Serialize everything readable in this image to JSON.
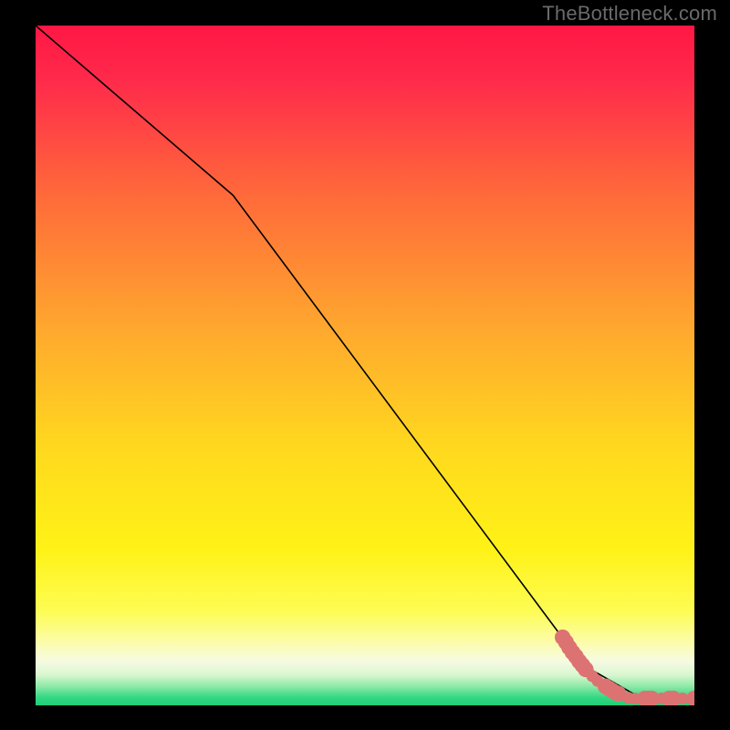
{
  "attribution": "TheBottleneck.com",
  "chart_data": {
    "type": "line",
    "title": "",
    "xlabel": "",
    "ylabel": "",
    "xlim": [
      0,
      100
    ],
    "ylim": [
      0,
      100
    ],
    "grid": false,
    "series": [
      {
        "name": "bottleneck-curve",
        "x": [
          0,
          30,
          83,
          92,
          100
        ],
        "y": [
          100,
          75,
          6,
          1,
          1
        ],
        "color": "#000000"
      }
    ],
    "markers": {
      "name": "data-points",
      "color": "#dd7272",
      "points": [
        {
          "x": 80.0,
          "y": 10.0,
          "r": 1.2
        },
        {
          "x": 80.5,
          "y": 9.3,
          "r": 1.2
        },
        {
          "x": 81.0,
          "y": 8.5,
          "r": 1.2
        },
        {
          "x": 81.5,
          "y": 7.8,
          "r": 1.2
        },
        {
          "x": 82.0,
          "y": 7.2,
          "r": 1.2
        },
        {
          "x": 82.5,
          "y": 6.5,
          "r": 1.2
        },
        {
          "x": 83.0,
          "y": 5.9,
          "r": 1.2
        },
        {
          "x": 83.5,
          "y": 5.3,
          "r": 1.2
        },
        {
          "x": 84.5,
          "y": 4.3,
          "r": 0.9
        },
        {
          "x": 85.3,
          "y": 3.6,
          "r": 0.9
        },
        {
          "x": 86.5,
          "y": 2.8,
          "r": 1.2
        },
        {
          "x": 87.0,
          "y": 2.5,
          "r": 1.2
        },
        {
          "x": 87.5,
          "y": 2.2,
          "r": 1.2
        },
        {
          "x": 88.0,
          "y": 1.9,
          "r": 1.2
        },
        {
          "x": 88.5,
          "y": 1.7,
          "r": 1.2
        },
        {
          "x": 90.0,
          "y": 1.1,
          "r": 0.9
        },
        {
          "x": 91.0,
          "y": 1.0,
          "r": 0.9
        },
        {
          "x": 92.5,
          "y": 1.0,
          "r": 1.2
        },
        {
          "x": 93.0,
          "y": 1.0,
          "r": 1.2
        },
        {
          "x": 93.5,
          "y": 1.0,
          "r": 1.2
        },
        {
          "x": 95.0,
          "y": 1.0,
          "r": 0.9
        },
        {
          "x": 96.2,
          "y": 1.0,
          "r": 1.2
        },
        {
          "x": 96.8,
          "y": 1.0,
          "r": 1.2
        },
        {
          "x": 98.2,
          "y": 1.0,
          "r": 0.9
        },
        {
          "x": 100.0,
          "y": 1.0,
          "r": 1.2
        }
      ]
    },
    "background_gradient": {
      "stops": [
        {
          "offset": 0.0,
          "color": "#ff1744"
        },
        {
          "offset": 0.08,
          "color": "#ff2a4b"
        },
        {
          "offset": 0.25,
          "color": "#ff6a3a"
        },
        {
          "offset": 0.45,
          "color": "#ffa92e"
        },
        {
          "offset": 0.62,
          "color": "#ffd81e"
        },
        {
          "offset": 0.77,
          "color": "#fff217"
        },
        {
          "offset": 0.86,
          "color": "#fdfc52"
        },
        {
          "offset": 0.905,
          "color": "#fcfca6"
        },
        {
          "offset": 0.935,
          "color": "#f6fbe2"
        },
        {
          "offset": 0.955,
          "color": "#d9f6d0"
        },
        {
          "offset": 0.972,
          "color": "#8ee9a8"
        },
        {
          "offset": 0.988,
          "color": "#34d884"
        },
        {
          "offset": 1.0,
          "color": "#1fce77"
        }
      ]
    }
  }
}
